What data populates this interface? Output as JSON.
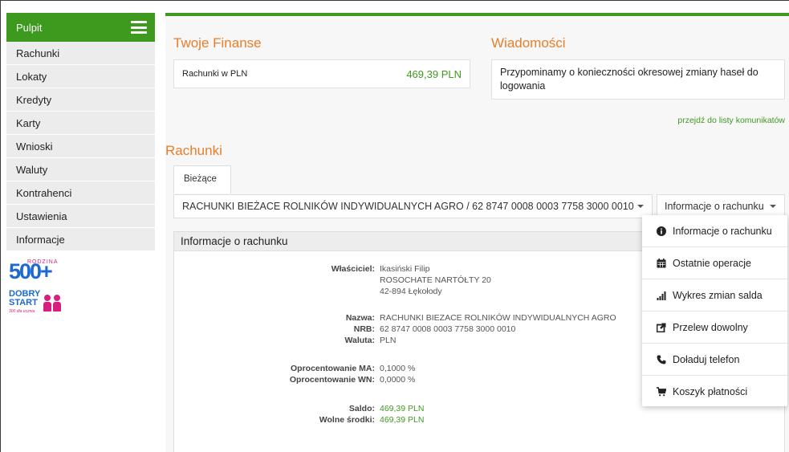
{
  "sidebar": {
    "top_label": "Pulpit",
    "items": [
      {
        "label": "Rachunki"
      },
      {
        "label": "Lokaty"
      },
      {
        "label": "Kredyty"
      },
      {
        "label": "Karty"
      },
      {
        "label": "Wnioski"
      },
      {
        "label": "Waluty"
      },
      {
        "label": "Kontrahenci"
      },
      {
        "label": "Ustawienia"
      },
      {
        "label": "Informacje"
      }
    ],
    "logo500": {
      "small": "RODZINA",
      "big": "500+"
    },
    "dobry_start": {
      "line1": "DOBRY",
      "line2": "START",
      "line3": "300 dla ucznia"
    }
  },
  "finance": {
    "title": "Twoje Finanse",
    "label": "Rachunki w PLN",
    "amount": "469,39 PLN"
  },
  "messages": {
    "title": "Wiadomości",
    "text": "Przypominamy o konieczności okresowej zmiany haseł do logowania",
    "link": "przejdź do listy komunikatów"
  },
  "accounts": {
    "title": "Rachunki",
    "tab": "Bieżące",
    "selected_account": "RACHUNKI BIEŻACE ROLNIKÓW INDYWIDUALNYCH AGRO / 62 8747 0008 0003 7758 3000 0010",
    "info_select": "Informacje o rachunku"
  },
  "panel": {
    "title": "Informacje o rachunku",
    "owner_label": "Właściciel:",
    "owner_name": "Ikasiński Filip",
    "owner_addr1": "ROSOCHATE NARTÓŁTY 20",
    "owner_addr2": "42-894 Łękołody",
    "name_label": "Nazwa:",
    "name_value": "RACHUNKI BIEZACE ROLNIKÓW INDYWIDUALNYCH AGRO",
    "nrb_label": "NRB:",
    "nrb_value": "62 8747 0008 0003 7758 3000 0010",
    "currency_label": "Waluta:",
    "currency_value": "PLN",
    "rate_ma_label": "Oprocentowanie MA:",
    "rate_ma_value": "0,1000 %",
    "rate_wn_label": "Oprocentowanie WN:",
    "rate_wn_value": "0,0000 %",
    "balance_label": "Saldo:",
    "balance_value": "469,39 PLN",
    "free_label": "Wolne środki:",
    "free_value": "469,39 PLN"
  },
  "dropdown": {
    "items": [
      {
        "label": "Informacje o rachunku",
        "icon": "info-circle-icon"
      },
      {
        "label": "Ostatnie operacje",
        "icon": "calendar-icon"
      },
      {
        "label": "Wykres zmian salda",
        "icon": "bar-chart-icon"
      },
      {
        "label": "Przelew dowolny",
        "icon": "external-link-icon"
      },
      {
        "label": "Doładuj telefon",
        "icon": "phone-icon"
      },
      {
        "label": "Koszyk płatności",
        "icon": "cart-icon"
      }
    ]
  },
  "colors": {
    "brand_green": "#3e9a1f",
    "accent_orange": "#e87e2a"
  }
}
